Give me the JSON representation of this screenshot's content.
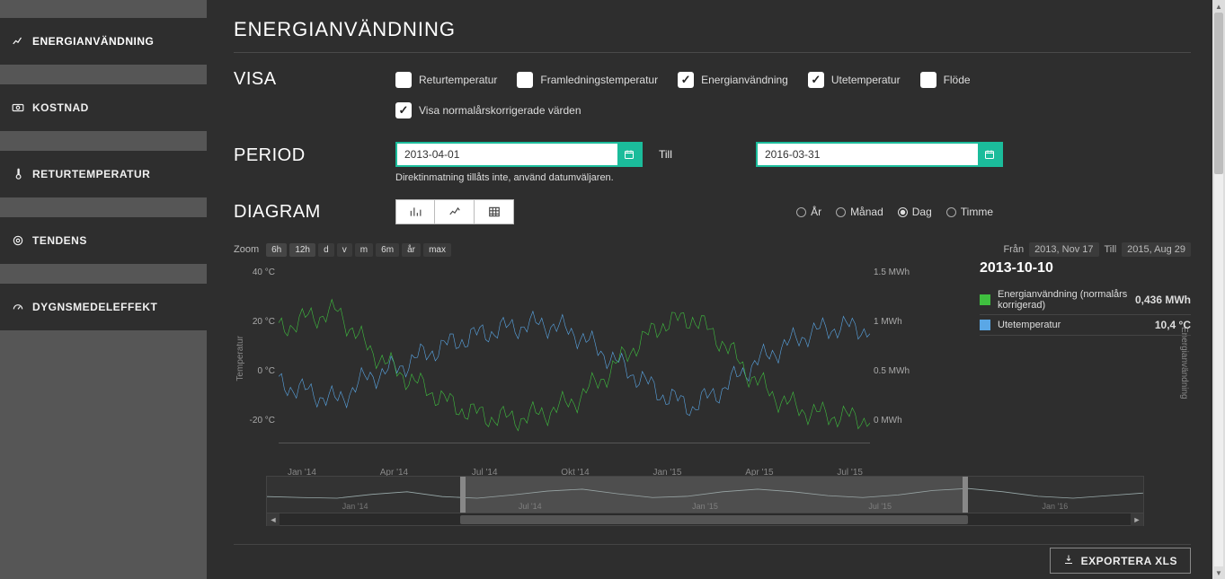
{
  "sidebar": {
    "items": [
      {
        "label": "ENERGIANVÄNDNING",
        "icon": "chart-line-icon",
        "active": true
      },
      {
        "label": "KOSTNAD",
        "icon": "money-icon",
        "active": false
      },
      {
        "label": "RETURTEMPERATUR",
        "icon": "thermometer-icon",
        "active": false
      },
      {
        "label": "TENDENS",
        "icon": "target-icon",
        "active": false
      },
      {
        "label": "DYGNSMEDELEFFEKT",
        "icon": "gauge-icon",
        "active": false
      }
    ]
  },
  "page": {
    "title": "ENERGIANVÄNDNING"
  },
  "sections": {
    "visa": "VISA",
    "period": "PERIOD",
    "diagram": "DIAGRAM"
  },
  "visa": {
    "options": [
      {
        "label": "Returtemperatur",
        "checked": false
      },
      {
        "label": "Framledningstemperatur",
        "checked": false
      },
      {
        "label": "Energianvändning",
        "checked": true
      },
      {
        "label": "Utetemperatur",
        "checked": true
      },
      {
        "label": "Flöde",
        "checked": false
      }
    ],
    "normal_corr": {
      "label": "Visa normalårskorrigerade värden",
      "checked": true
    }
  },
  "period": {
    "from": "2013-04-01",
    "to": "2016-03-31",
    "till_label": "Till",
    "hint": "Direktinmatning tillåts inte, använd datumväljaren."
  },
  "diagram": {
    "types": [
      "bar",
      "line",
      "table"
    ],
    "granularity": [
      {
        "label": "År",
        "sel": false
      },
      {
        "label": "Månad",
        "sel": false
      },
      {
        "label": "Dag",
        "sel": true
      },
      {
        "label": "Timme",
        "sel": false
      }
    ]
  },
  "zoom": {
    "label": "Zoom",
    "buttons": [
      "6h",
      "12h",
      "d",
      "v",
      "m",
      "6m",
      "år",
      "max"
    ],
    "from_label": "Från",
    "from": "2013, Nov 17",
    "till_label": "Till",
    "till": "2015, Aug 29"
  },
  "legend": {
    "date": "2013-10-10",
    "rows": [
      {
        "color": "#3fbf3f",
        "label": "Energianvändning (normalårs korrigerad)",
        "value": "0,436 MWh"
      },
      {
        "color": "#5aa7e6",
        "label": "Utetemperatur",
        "value": "10,4 °C"
      }
    ]
  },
  "export": {
    "label": "EXPORTERA XLS"
  },
  "chart_data": {
    "type": "line",
    "y_left": {
      "label": "Temperatur",
      "ticks": [
        "40 °C",
        "20 °C",
        "0 °C",
        "-20 °C"
      ],
      "range": [
        -20,
        40
      ]
    },
    "y_right": {
      "label": "Energianvändning",
      "ticks": [
        "1.5 MWh",
        "1 MWh",
        "0.5 MWh",
        "0 MWh"
      ],
      "range": [
        0,
        1.5
      ]
    },
    "x_ticks": [
      "Jan '14",
      "Apr '14",
      "Jul '14",
      "Okt '14",
      "Jan '15",
      "Apr '15",
      "Jul '15"
    ],
    "nav_ticks": [
      "Jan '14",
      "Jul '14",
      "Jan '15",
      "Jul '15",
      "Jan '16"
    ],
    "nav_window": {
      "start_pct": 22,
      "end_pct": 80
    },
    "series": [
      {
        "name": "Utetemperatur",
        "color": "#5aa7e6",
        "axis": "left",
        "x_pct": [
          0,
          5,
          10,
          15,
          20,
          25,
          30,
          35,
          40,
          45,
          50,
          55,
          60,
          65,
          70,
          75,
          80,
          85,
          90,
          95,
          100
        ],
        "values": [
          0,
          -3,
          -6,
          2,
          5,
          10,
          14,
          17,
          19,
          20,
          17,
          10,
          3,
          -4,
          -8,
          -2,
          6,
          12,
          17,
          19,
          18
        ]
      },
      {
        "name": "Energianvändning (normalårs korrigerad)",
        "color": "#3fbf3f",
        "axis": "right",
        "x_pct": [
          0,
          5,
          10,
          15,
          20,
          25,
          30,
          35,
          40,
          45,
          50,
          55,
          60,
          65,
          70,
          75,
          80,
          85,
          90,
          95,
          100
        ],
        "values": [
          0.95,
          1.05,
          1.1,
          0.8,
          0.6,
          0.45,
          0.3,
          0.22,
          0.2,
          0.25,
          0.35,
          0.55,
          0.8,
          1.0,
          1.05,
          0.85,
          0.55,
          0.35,
          0.25,
          0.22,
          0.2
        ]
      }
    ],
    "nav_series": {
      "x_pct": [
        0,
        4,
        8,
        12,
        16,
        20,
        24,
        28,
        32,
        36,
        40,
        44,
        48,
        52,
        56,
        60,
        64,
        68,
        72,
        76,
        80,
        84,
        88,
        92,
        96,
        100
      ],
      "values": [
        0.55,
        0.52,
        0.5,
        0.62,
        0.7,
        0.55,
        0.5,
        0.6,
        0.72,
        0.78,
        0.64,
        0.52,
        0.56,
        0.7,
        0.78,
        0.7,
        0.58,
        0.52,
        0.6,
        0.74,
        0.8,
        0.7,
        0.56,
        0.5,
        0.58,
        0.66
      ]
    }
  }
}
